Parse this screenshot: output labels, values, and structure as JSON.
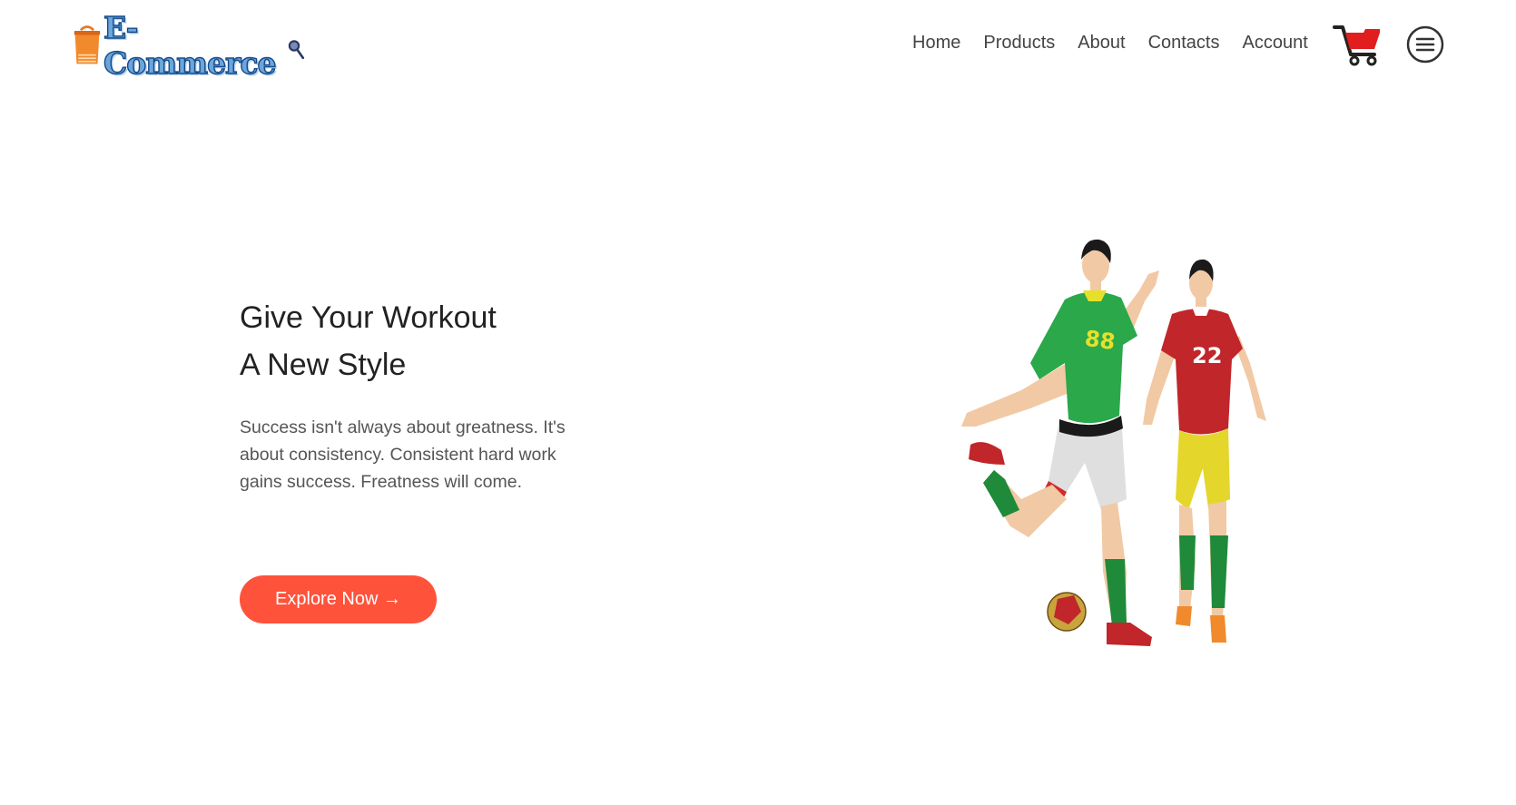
{
  "brand": {
    "logo_text": "E-Commerce",
    "accent": "#ff523b",
    "logo_blue": "#6aa6da",
    "logo_orange": "#e87722"
  },
  "nav": {
    "items": [
      {
        "label": "Home"
      },
      {
        "label": "Products"
      },
      {
        "label": "About"
      },
      {
        "label": "Contacts"
      },
      {
        "label": "Account"
      }
    ],
    "cart_icon": "shopping-cart-icon",
    "menu_icon": "hamburger-menu-icon"
  },
  "hero": {
    "title_line1": "Give Your Workout",
    "title_line2": "A New Style",
    "description": "Success isn't always about greatness. It's about consistency. Consistent hard work gains success. Freatness will come.",
    "button_label": "Explore Now →",
    "image_alt": "football-players-illustration",
    "player1_number": "88",
    "player2_number": "22"
  }
}
